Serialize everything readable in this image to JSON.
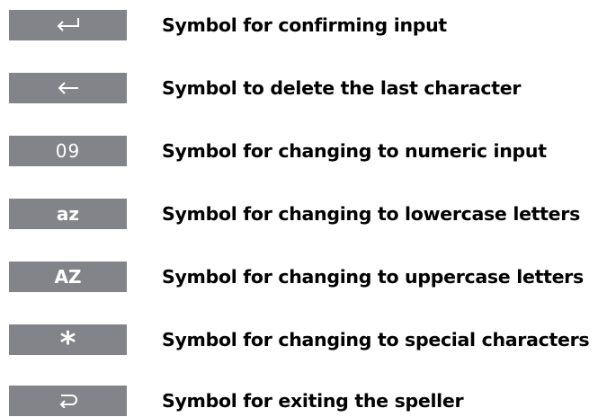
{
  "legend": [
    {
      "symbol_icon": "return-arrow-icon",
      "description": "Symbol for confirming input"
    },
    {
      "symbol_icon": "backspace-arrow-icon",
      "description": "Symbol to delete the last character"
    },
    {
      "symbol_text": "09",
      "description": "Symbol for changing to numeric input"
    },
    {
      "symbol_text": "az",
      "description": "Symbol for changing to lowercase letters"
    },
    {
      "symbol_text": "AZ",
      "description": "Symbol for changing to uppercase letters"
    },
    {
      "symbol_text": "*",
      "description": "Symbol for changing to special characters"
    },
    {
      "symbol_icon": "exit-arrow-icon",
      "description": "Symbol for exiting the speller"
    }
  ],
  "colors": {
    "key_background": "#838489",
    "key_foreground": "#ffffff",
    "text": "#000000"
  }
}
